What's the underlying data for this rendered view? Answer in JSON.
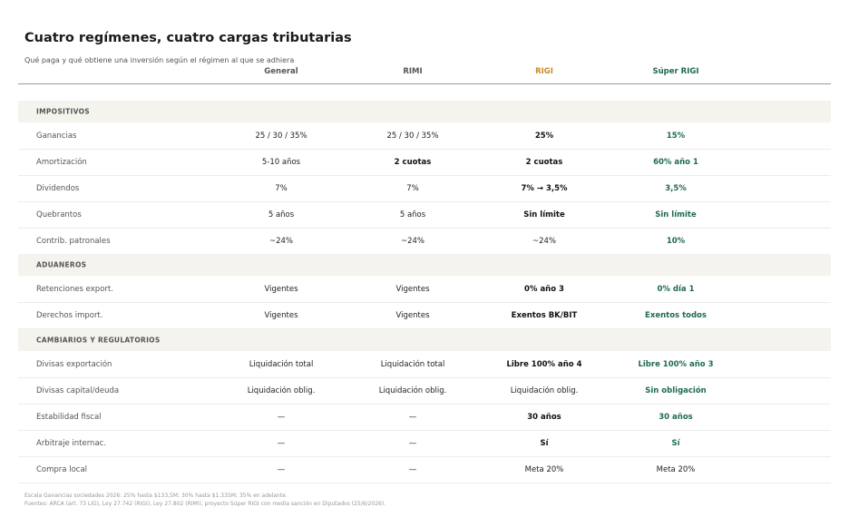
{
  "title": "Cuatro regímenes, cuatro cargas tributarias",
  "subtitle": "Qué paga y qué obtiene una inversión según el régimen al que se adhiera",
  "colors": {
    "rigi": "#c98a2c",
    "super_rigi": "#1f6b4e",
    "text": "#222222",
    "section_bg": "#f4f3ee"
  },
  "columns": [
    "General",
    "RIMI",
    "RIGI",
    "Súper RIGI"
  ],
  "sections": [
    {
      "label": "IMPOSITIVOS",
      "rows": [
        {
          "label": "Ganancias",
          "cells": [
            {
              "text": "25 / 30 / 35%",
              "style": "n"
            },
            {
              "text": "25 / 30 / 35%",
              "style": "n"
            },
            {
              "text": "25%",
              "style": "b"
            },
            {
              "text": "15%",
              "style": "g"
            }
          ]
        },
        {
          "label": "Amortización",
          "cells": [
            {
              "text": "5-10 años",
              "style": "n"
            },
            {
              "text": "2 cuotas",
              "style": "b"
            },
            {
              "text": "2 cuotas",
              "style": "b"
            },
            {
              "text": "60% año 1",
              "style": "g"
            }
          ]
        },
        {
          "label": "Dividendos",
          "cells": [
            {
              "text": "7%",
              "style": "n"
            },
            {
              "text": "7%",
              "style": "n"
            },
            {
              "text": "7% → 3,5%",
              "style": "b"
            },
            {
              "text": "3,5%",
              "style": "g"
            }
          ]
        },
        {
          "label": "Quebrantos",
          "cells": [
            {
              "text": "5 años",
              "style": "n"
            },
            {
              "text": "5 años",
              "style": "n"
            },
            {
              "text": "Sin límite",
              "style": "b"
            },
            {
              "text": "Sin límite",
              "style": "g"
            }
          ]
        },
        {
          "label": "Contrib. patronales",
          "cells": [
            {
              "text": "~24%",
              "style": "n"
            },
            {
              "text": "~24%",
              "style": "n"
            },
            {
              "text": "~24%",
              "style": "n"
            },
            {
              "text": "10%",
              "style": "g"
            }
          ]
        }
      ]
    },
    {
      "label": "ADUANEROS",
      "rows": [
        {
          "label": "Retenciones export.",
          "cells": [
            {
              "text": "Vigentes",
              "style": "n"
            },
            {
              "text": "Vigentes",
              "style": "n"
            },
            {
              "text": "0% año 3",
              "style": "b"
            },
            {
              "text": "0% día 1",
              "style": "g"
            }
          ]
        },
        {
          "label": "Derechos import.",
          "cells": [
            {
              "text": "Vigentes",
              "style": "n"
            },
            {
              "text": "Vigentes",
              "style": "n"
            },
            {
              "text": "Exentos BK/BIT",
              "style": "b"
            },
            {
              "text": "Exentos todos",
              "style": "g"
            }
          ]
        }
      ]
    },
    {
      "label": "CAMBIARIOS Y REGULATORIOS",
      "rows": [
        {
          "label": "Divisas exportación",
          "cells": [
            {
              "text": "Liquidación total",
              "style": "n"
            },
            {
              "text": "Liquidación total",
              "style": "n"
            },
            {
              "text": "Libre 100% año 4",
              "style": "b"
            },
            {
              "text": "Libre 100% año 3",
              "style": "g"
            }
          ]
        },
        {
          "label": "Divisas capital/deuda",
          "cells": [
            {
              "text": "Liquidación oblig.",
              "style": "n"
            },
            {
              "text": "Liquidación oblig.",
              "style": "n"
            },
            {
              "text": "Liquidación oblig.",
              "style": "n"
            },
            {
              "text": "Sin obligación",
              "style": "g"
            }
          ]
        },
        {
          "label": "Estabilidad fiscal",
          "cells": [
            {
              "text": "—",
              "style": "n"
            },
            {
              "text": "—",
              "style": "n"
            },
            {
              "text": "30 años",
              "style": "b"
            },
            {
              "text": "30 años",
              "style": "g"
            }
          ]
        },
        {
          "label": "Arbitraje internac.",
          "cells": [
            {
              "text": "—",
              "style": "n"
            },
            {
              "text": "—",
              "style": "n"
            },
            {
              "text": "Sí",
              "style": "b"
            },
            {
              "text": "Sí",
              "style": "g"
            }
          ]
        },
        {
          "label": "Compra local",
          "cells": [
            {
              "text": "—",
              "style": "n"
            },
            {
              "text": "—",
              "style": "n"
            },
            {
              "text": "Meta 20%",
              "style": "n"
            },
            {
              "text": "Meta 20%",
              "style": "n"
            }
          ]
        }
      ]
    }
  ],
  "footnotes": [
    "Escala Ganancias sociedades 2026: 25% hasta $133,5M; 30% hasta $1.335M; 35% en adelante.",
    "Fuentes: ARCA (art. 73 LIG), Ley 27.742 (RIGI), Ley 27.802 (RIMI), proyecto Súper RIGI con media sanción en Diputados (25/6/2026)."
  ]
}
